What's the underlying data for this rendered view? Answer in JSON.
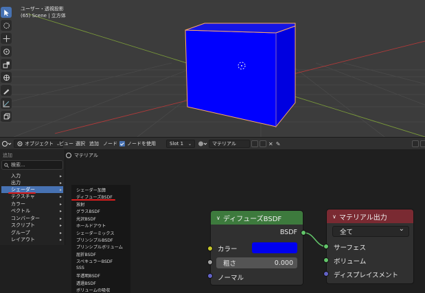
{
  "viewport": {
    "title": "ユーザー・透視投影",
    "subtitle": "(65) Scene | 立方体",
    "tools": [
      "select-icon",
      "cursor-icon",
      "move-icon",
      "rotate-icon",
      "scale-icon",
      "transform-icon",
      "annotate-icon",
      "measure-icon",
      "add-cube-icon"
    ],
    "cube_color": "#0000ff",
    "outline_color": "#ffaa66"
  },
  "node_header": {
    "editor_type_icon": "node-editor-icon",
    "object_dropdown": "オブジェクト",
    "menus": [
      "ビュー",
      "選択",
      "追加",
      "ノード"
    ],
    "use_nodes_label": "ノードを使用",
    "slot_dropdown": "Slot 1",
    "material_name": "マテリアル"
  },
  "breadcrumb": {
    "label": "マテリアル"
  },
  "add_menu": {
    "title": "追加",
    "search_placeholder": "検索...",
    "categories": [
      "入力",
      "出力",
      "シェーダー",
      "テクスチャ",
      "カラー",
      "ベクトル",
      "コンバーター",
      "スクリプト",
      "グループ",
      "レイアウト"
    ],
    "active_category": "シェーダー"
  },
  "shader_submenu": {
    "items": [
      "シェーダー加算",
      "ディフューズBSDF",
      "放射",
      "グラスBSDF",
      "光沢BSDF",
      "ホールドアウト",
      "シェーダーミックス",
      "プリンシプルBSDF",
      "プリンシプルボリューム",
      "屈折BSDF",
      "スペキュラーBSDF",
      "SSS",
      "半透明BSDF",
      "透過BSDF",
      "ボリュームの吸収"
    ],
    "highlighted": "ディフューズBSDF"
  },
  "diffuse_node": {
    "title": "ディフューズBSDF",
    "header_color": "#3d7a3d",
    "output_label": "BSDF",
    "color_label": "カラー",
    "color_value": "#0000ee",
    "roughness_label": "粗さ",
    "roughness_value": "0.000",
    "normal_label": "ノーマル"
  },
  "output_node": {
    "title": "マテリアル出力",
    "header_color": "#7a2a32",
    "target": "全て",
    "inputs": [
      "サーフェス",
      "ボリューム",
      "ディスプレイスメント"
    ]
  }
}
